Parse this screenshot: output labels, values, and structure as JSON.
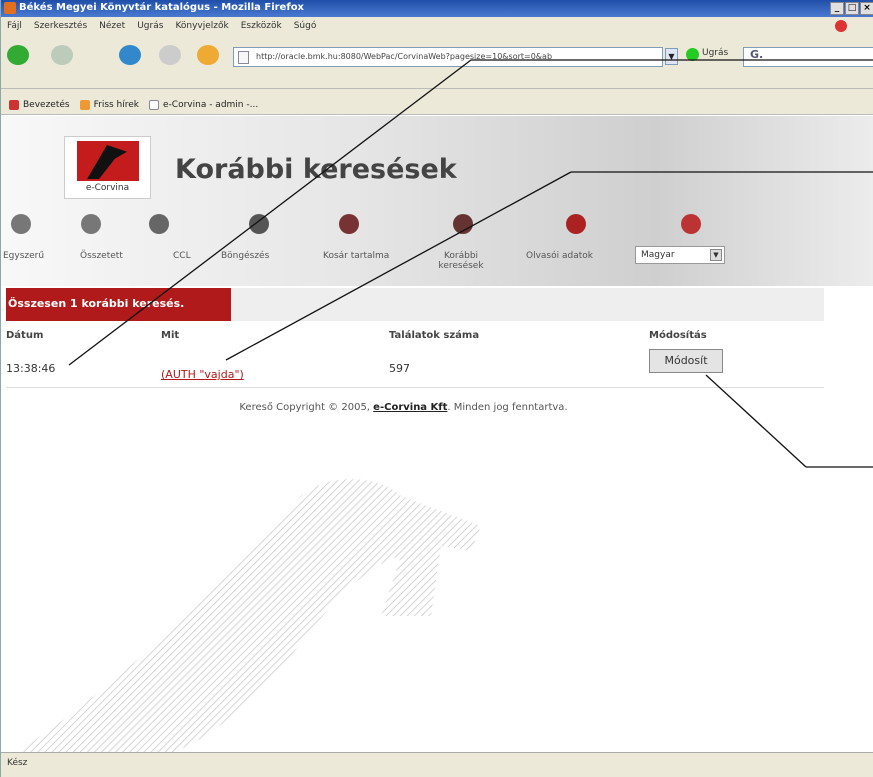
{
  "window": {
    "title": "Békés Megyei Könyvtár katalógus - Mozilla Firefox",
    "btn_min": "_",
    "btn_max": "□",
    "btn_close": "×"
  },
  "menu": {
    "items": [
      "Fájl",
      "Szerkesztés",
      "Nézet",
      "Ugrás",
      "Könyvjelzők",
      "Eszközök",
      "Súgó"
    ]
  },
  "navbar": {
    "url": "http://oracle.bmk.hu:8080/WebPac/CorvinaWeb?pagesize=10&sort=0&ab",
    "go_label": "Ugrás",
    "search_placeholder": "G."
  },
  "bookmarks": {
    "items": [
      "Bevezetés",
      "Friss hírek",
      "e-Corvina - admin -..."
    ]
  },
  "header": {
    "logo_text": "e-Corvina",
    "page_title": "Korábbi keresések",
    "nav_items": [
      "Egyszerű",
      "Összetett",
      "CCL",
      "Böngészés",
      "Kosár tartalma",
      "Korábbi keresések",
      "Olvasói adatok"
    ],
    "language": "Magyar"
  },
  "results": {
    "summary": "Összesen 1 korábbi keresés.",
    "columns": [
      "Dátum",
      "Mit",
      "Találatok száma",
      "Módosítás"
    ],
    "rows": [
      {
        "date": "13:38:46",
        "query": "(AUTH \"vajda\")",
        "hits": "597",
        "action": "Módosít"
      }
    ]
  },
  "footer": {
    "text_before": "Kereső Copyright © 2005, ",
    "company": "e-Corvina Kft",
    "text_after": ". Minden jog fenntartva."
  },
  "status": {
    "text": "Kész"
  }
}
